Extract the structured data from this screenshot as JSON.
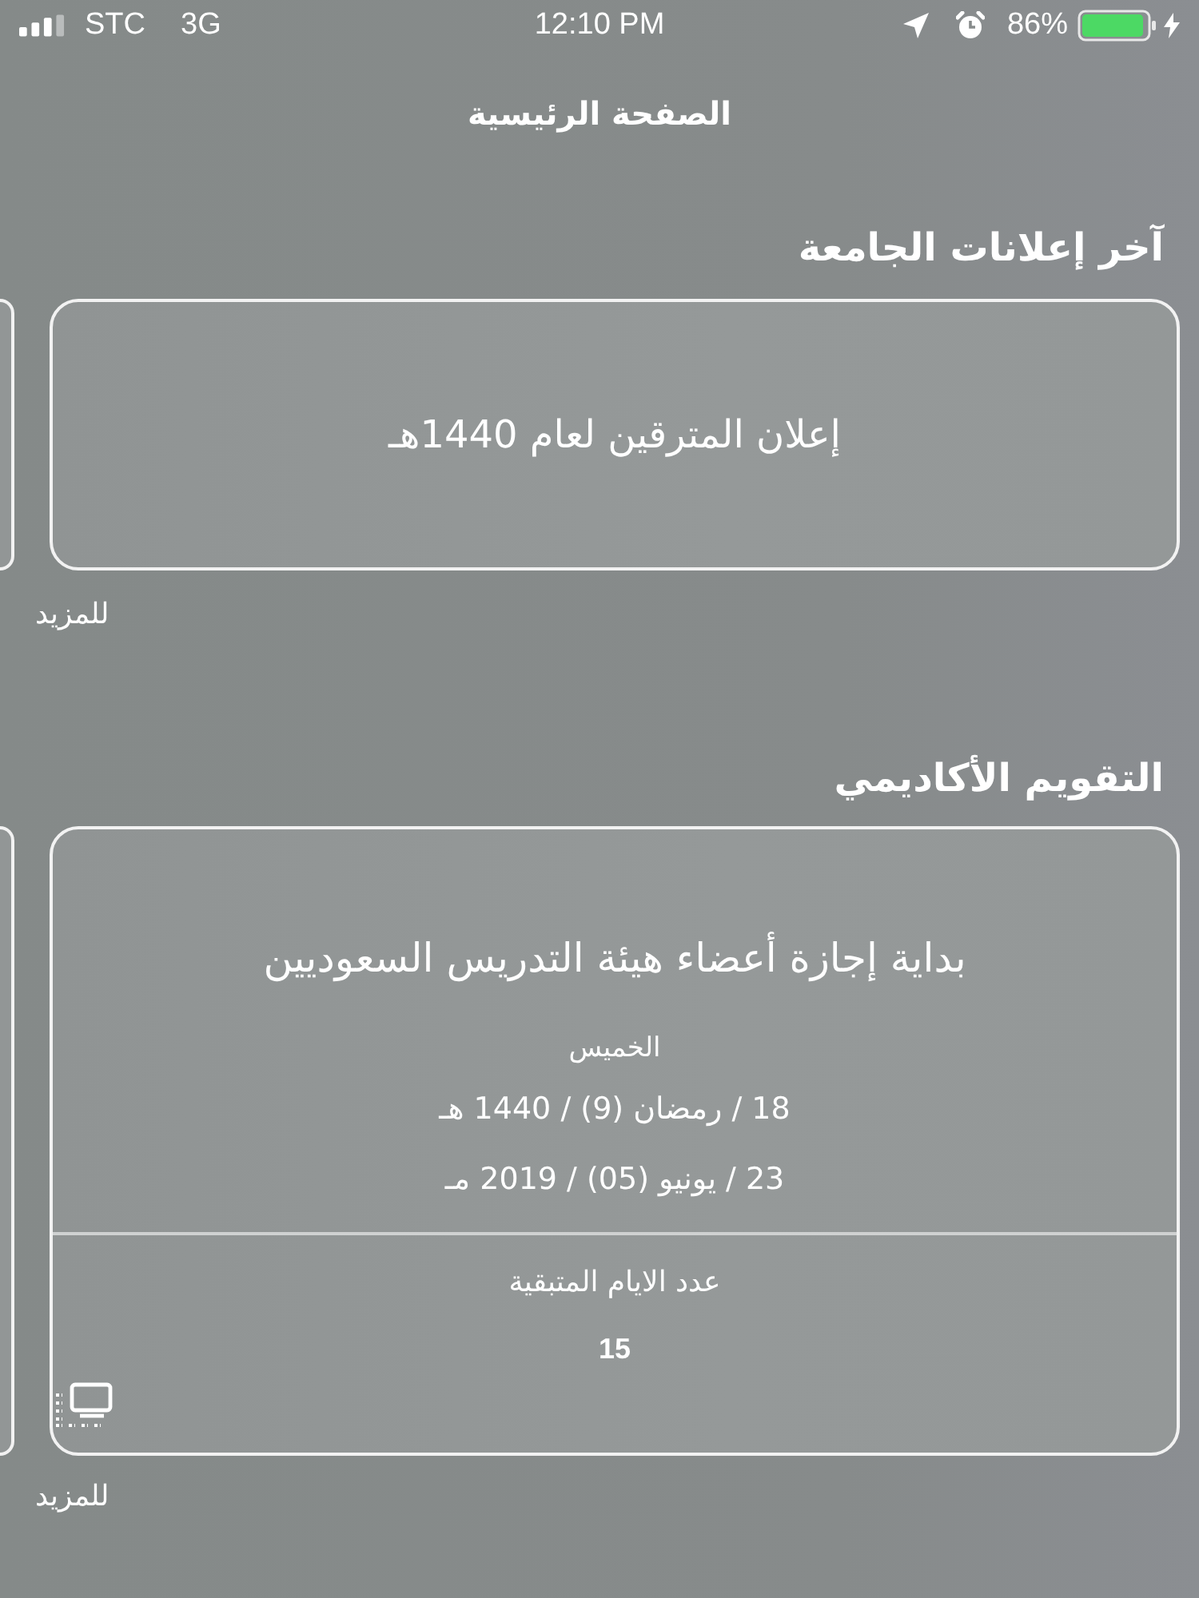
{
  "status_bar": {
    "carrier": "STC",
    "network": "3G",
    "time": "12:10 PM",
    "battery_percent": "86%"
  },
  "header": {
    "title": "الصفحة الرئيسية"
  },
  "sections": [
    {
      "kind": "announcements",
      "title": "آخر إعلانات الجامعة",
      "card": {
        "text": "إعلان المترقين لعام 1440هـ"
      },
      "more_link": "للمزيد"
    },
    {
      "kind": "calendar",
      "title": "التقويم الأكاديمي",
      "card": {
        "event": "بداية إجازة أعضاء هيئة التدريس السعوديين",
        "weekday": "الخميس",
        "hijri_date": "18 / رمضان (9) / 1440 هـ",
        "gregorian_date": "23 / يونيو (05) / 2019 مـ",
        "remaining_label": "عدد الايام المتبقية",
        "remaining_days": "15"
      },
      "more_link": "للمزيد"
    }
  ]
}
